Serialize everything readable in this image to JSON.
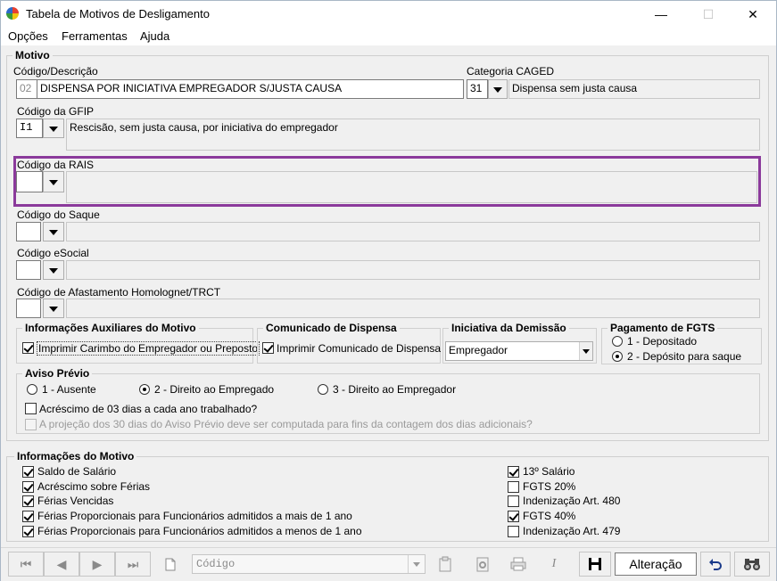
{
  "window": {
    "title": "Tabela de Motivos de Desligamento",
    "controls": {
      "minimize": "—",
      "maximize": "☐",
      "close": "✕"
    }
  },
  "menu": [
    "Opções",
    "Ferramentas",
    "Ajuda"
  ],
  "motivo": {
    "group_title": "Motivo",
    "codigo_label": "Código/Descrição",
    "codigo_value": "02",
    "descricao_value": "DISPENSA POR INICIATIVA EMPREGADOR S/JUSTA CAUSA",
    "caged_label": "Categoria CAGED",
    "caged_code": "31",
    "caged_desc": "Dispensa sem justa causa",
    "gfip_label": "Código da GFIP",
    "gfip_code": "I1",
    "gfip_desc": "Rescisão, sem justa causa, por iniciativa do empregador",
    "rais_label": "Código da RAIS",
    "saque_label": "Código do Saque",
    "esocial_label": "Código eSocial",
    "homolognet_label": "Código de Afastamento Homolognet/TRCT"
  },
  "aux": {
    "title": "Informações Auxiliares do Motivo",
    "carimbo_label": "Imprimir Carimbo do Empregador ou Preposto",
    "carimbo_checked": true
  },
  "comunicado": {
    "title": "Comunicado de Dispensa",
    "imprimir_label": "Imprimir Comunicado de Dispensa",
    "imprimir_checked": true
  },
  "iniciativa": {
    "title": "Iniciativa da Demissão",
    "selected": "Empregador"
  },
  "fgts": {
    "title": "Pagamento de FGTS",
    "options": [
      "1 - Depositado",
      "2 - Depósito para saque"
    ],
    "selected_index": 1
  },
  "aviso": {
    "title": "Aviso Prévio",
    "options": [
      "1 - Ausente",
      "2 - Direito ao Empregado",
      "3 - Direito ao Empregador"
    ],
    "selected_index": 1,
    "acrescimo_label": "Acréscimo de 03 dias a cada ano trabalhado?",
    "projecao_label": "A projeção dos 30 dias do Aviso Prévio deve ser computada para fins da contagem dos dias adicionais?"
  },
  "info": {
    "title": "Informações do Motivo",
    "left": [
      {
        "label": "Saldo de Salário",
        "checked": true
      },
      {
        "label": "Acréscimo sobre Férias",
        "checked": true
      },
      {
        "label": "Férias Vencidas",
        "checked": true
      },
      {
        "label": "Férias Proporcionais para Funcionários admitidos a mais de 1 ano",
        "checked": true
      },
      {
        "label": "Férias Proporcionais para Funcionários admitidos a menos de 1 ano",
        "checked": true
      }
    ],
    "right": [
      {
        "label": "13º Salário",
        "checked": true
      },
      {
        "label": "FGTS 20%",
        "checked": false
      },
      {
        "label": "Indenização Art. 480",
        "checked": false
      },
      {
        "label": "FGTS 40%",
        "checked": true
      },
      {
        "label": "Indenização Art. 479",
        "checked": false
      }
    ]
  },
  "toolbar": {
    "first": "⏮",
    "prev": "◀",
    "next": "▶",
    "last": "⏭",
    "search_placeholder": "Código",
    "status": "Alteração"
  }
}
